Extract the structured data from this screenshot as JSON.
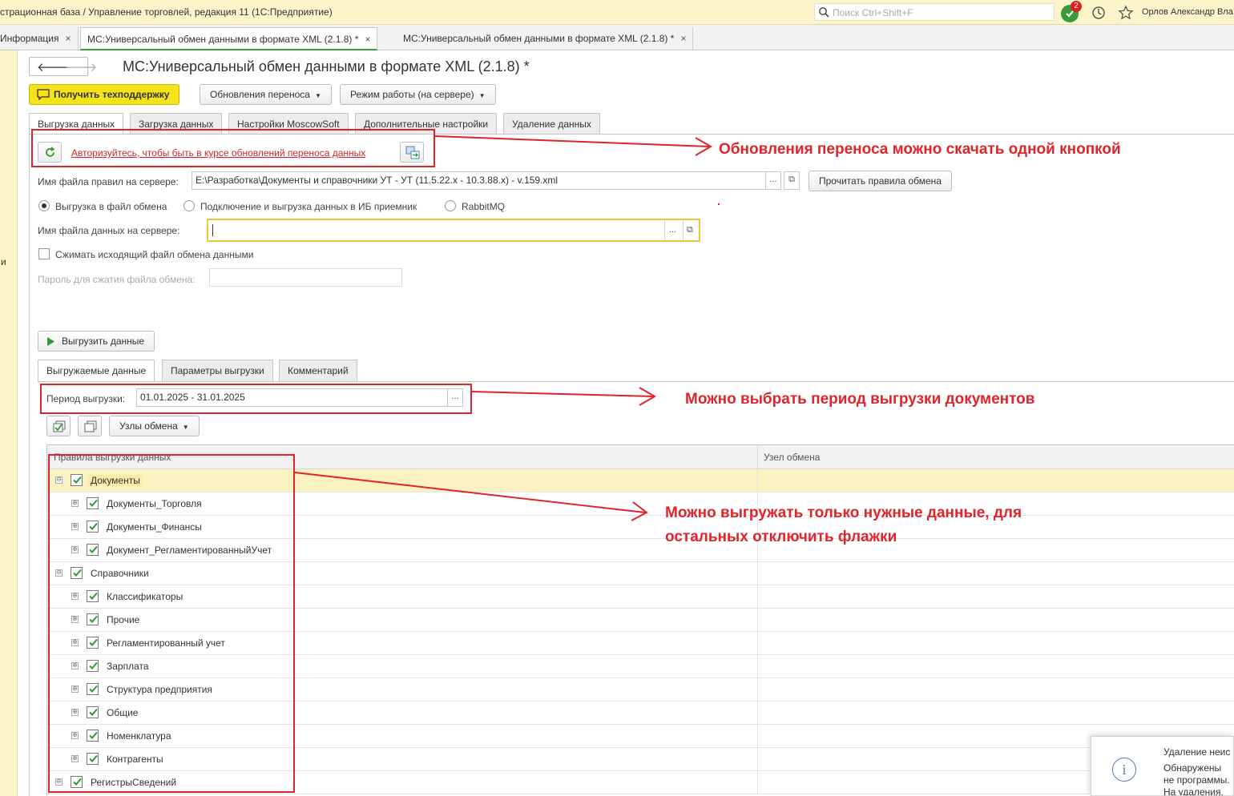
{
  "window": {
    "title": "страционная база / Управление торговлей, редакция 11  (1С:Предприятие)",
    "search_placeholder": "Поиск Ctrl+Shift+F",
    "notifications_count": "2",
    "user": "Орлов Александр Вла"
  },
  "window_tabs": [
    {
      "label": "Информация",
      "close": "×"
    },
    {
      "label": "МС:Универсальный обмен данными в формате XML (2.1.8) *",
      "close": "×"
    },
    {
      "label": "МС:Универсальный обмен данными в формате XML (2.1.8) *",
      "close": "×"
    }
  ],
  "left_strip_text": "и",
  "nav": {
    "back": "🡐",
    "forward": "🡒"
  },
  "document": {
    "title": "МС:Универсальный обмен данными в формате XML (2.1.8) *"
  },
  "toolbar": {
    "support": "Получить техподдержку",
    "updates": "Обновления переноса",
    "mode": "Режим работы (на сервере)"
  },
  "form_tabs": [
    "Выгрузка данных",
    "Загрузка данных",
    "Настройки MoscowSoft",
    "Дополнительные настройки",
    "Удаление данных"
  ],
  "auth_link": "Авторизуйтесь, чтобы быть в курсе обновлений переноса данных",
  "rules_file": {
    "label": "Имя файла правил на сервере:",
    "value": "E:\\Разработка\\Документы и справочники УТ - УТ (11.5.22.x - 10.3.88.x) - v.159.xml",
    "read_button": "Прочитать правила обмена"
  },
  "export_mode": {
    "options": [
      "Выгрузка в файл обмена",
      "Подключение и выгрузка данных в ИБ приемник",
      "RabbitMQ"
    ],
    "selected": "Выгрузка в файл обмена"
  },
  "data_file": {
    "label": "Имя файла данных на сервере:",
    "value": ""
  },
  "compress": {
    "label": "Сжимать исходящий файл обмена данными",
    "checked": false
  },
  "password": {
    "label": "Пароль для сжатия файла обмена:",
    "value": ""
  },
  "export_button": "Выгрузить данные",
  "inner_tabs": [
    "Выгружаемые данные",
    "Параметры выгрузки",
    "Комментарий"
  ],
  "period": {
    "label": "Период выгрузки:",
    "value": "01.01.2025 - 31.01.2025"
  },
  "nodes_button": "Узлы обмена",
  "table": {
    "columns": [
      "Правила выгрузки данных",
      "Узел обмена"
    ],
    "rows": [
      {
        "name": "Документы",
        "level": 0,
        "expander": "⊖",
        "checked": true
      },
      {
        "name": "Документы_Торговля",
        "level": 1,
        "expander": "⊕",
        "checked": true
      },
      {
        "name": "Документы_Финансы",
        "level": 1,
        "expander": "⊕",
        "checked": true
      },
      {
        "name": "Документ_РегламентированныйУчет",
        "level": 1,
        "expander": "⊕",
        "checked": true
      },
      {
        "name": "Справочники",
        "level": 0,
        "expander": "⊖",
        "checked": true
      },
      {
        "name": "Классификаторы",
        "level": 1,
        "expander": "⊕",
        "checked": true
      },
      {
        "name": "Прочие",
        "level": 1,
        "expander": "⊕",
        "checked": true
      },
      {
        "name": "Регламентированный учет",
        "level": 1,
        "expander": "⊕",
        "checked": true
      },
      {
        "name": "Зарплата",
        "level": 1,
        "expander": "⊕",
        "checked": true
      },
      {
        "name": "Структура предприятия",
        "level": 1,
        "expander": "⊕",
        "checked": true
      },
      {
        "name": "Общие",
        "level": 1,
        "expander": "⊕",
        "checked": true
      },
      {
        "name": "Номенклатура",
        "level": 1,
        "expander": "⊕",
        "checked": true
      },
      {
        "name": "Контрагенты",
        "level": 1,
        "expander": "⊕",
        "checked": true
      },
      {
        "name": "РегистрыСведений",
        "level": 0,
        "expander": "⊖",
        "checked": true
      }
    ]
  },
  "annotations": {
    "updates": "Обновления переноса можно скачать одной кнопкой",
    "period": "Можно выбрать период выгрузки документов",
    "data_line1": "Можно выгружать только нужные данные, для",
    "data_line2": "остальных отключить флажки"
  },
  "popup": {
    "icon": "i",
    "title": "Удаление неис",
    "text": "Обнаружены не программы. На удаления."
  },
  "colors": {
    "accent_green": "#3aa03a",
    "annotation_red": "#e0242b",
    "title_bar": "#fbf5c9",
    "support_button": "#f5e21a",
    "selected_row": "#fcf1c0"
  }
}
